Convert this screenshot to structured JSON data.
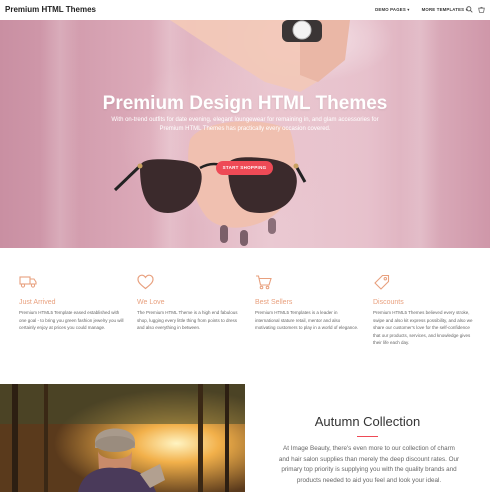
{
  "header": {
    "brand": "Premium HTML Themes",
    "nav": [
      {
        "label": "DEMO PAGES ▾"
      },
      {
        "label": "MORE TEMPLATES ▾"
      }
    ]
  },
  "hero": {
    "title": "Premium Design HTML Themes",
    "subtitle": "With on-trend outfits for date evening, elegant loungewear for remaining in, and glam accessories for Premium HTML Themes has practically every occasion covered.",
    "button_label": "START SHOPPING",
    "accent_color": "#ee4a56"
  },
  "features": [
    {
      "icon": "truck-icon",
      "title": "Just Arrived",
      "description": "Premium HTML5 Template eased established with one goal - to bring you green fashion jewelry you will certainly enjoy at prices you could manage."
    },
    {
      "icon": "heart-icon",
      "title": "We Love",
      "description": "The Premium HTML Theme is a high end fabulous shop, lugging every little thing from points to dress and also everything in between."
    },
    {
      "icon": "cart-icon",
      "title": "Best Sellers",
      "description": "Premium HTML5 Templates is a leader in international stature retail, mentor and also motivating customers to play in a world of elegance."
    },
    {
      "icon": "tag-icon",
      "title": "Discounts",
      "description": "Premium HTML5 Themes believed every stroke, swipe and also kit express possibility, and also we share our customer's love for the self-confidence that our products, services, and knowledge gives their life each day."
    }
  ],
  "feature_title_color": "#e8a07e",
  "collection": {
    "title": "Autumn Collection",
    "description": "At Image Beauty, there's even more to our collection of charm and hair salon supplies than merely the deep discount rates. Our primary top priority is supplying you with the quality brands and products needed to aid you feel and look your ideal."
  }
}
